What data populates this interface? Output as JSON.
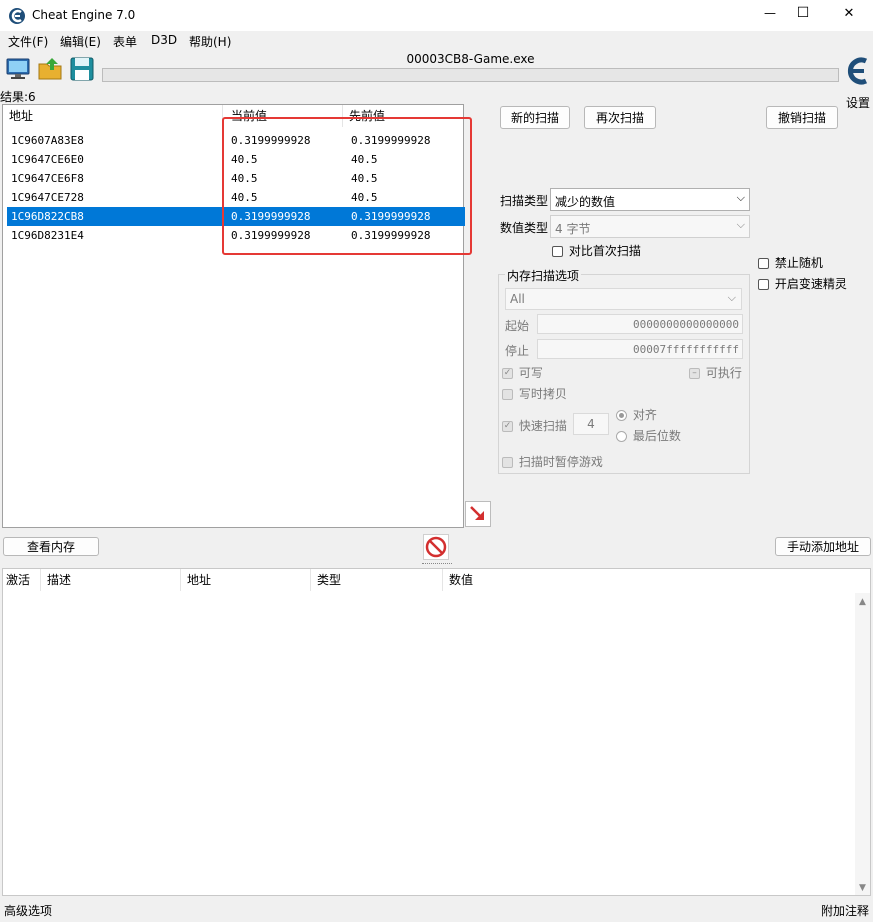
{
  "window": {
    "title": "Cheat Engine 7.0",
    "controls": {
      "minimize": "—",
      "maximize": "☐",
      "close": "✕"
    }
  },
  "menu": [
    "文件(F)",
    "编辑(E)",
    "表单",
    "D3D",
    "帮助(H)"
  ],
  "process_name": "00003CB8-Game.exe",
  "results_label": "结果:6",
  "settings_label": "设置",
  "results_table": {
    "headers": [
      "地址",
      "当前值",
      "先前值"
    ],
    "rows": [
      {
        "address": "1C9607A83E8",
        "current": "0.3199999928",
        "previous": "0.3199999928",
        "selected": false
      },
      {
        "address": "1C9647CE6E0",
        "current": "40.5",
        "previous": "40.5",
        "selected": false
      },
      {
        "address": "1C9647CE6F8",
        "current": "40.5",
        "previous": "40.5",
        "selected": false
      },
      {
        "address": "1C9647CE728",
        "current": "40.5",
        "previous": "40.5",
        "selected": false
      },
      {
        "address": "1C96D822CB8",
        "current": "0.3199999928",
        "previous": "0.3199999928",
        "selected": true
      },
      {
        "address": "1C96D8231E4",
        "current": "0.3199999928",
        "previous": "0.3199999928",
        "selected": false
      }
    ]
  },
  "buttons": {
    "new_scan": "新的扫描",
    "next_scan": "再次扫描",
    "undo_scan": "撤销扫描",
    "view_memory": "查看内存",
    "add_address": "手动添加地址"
  },
  "scan": {
    "scan_type_label": "扫描类型",
    "scan_type_value": "减少的数值",
    "value_type_label": "数值类型",
    "value_type_value": "4 字节",
    "compare_first": "对比首次扫描",
    "disable_random": "禁止随机",
    "speedhack": "开启变速精灵"
  },
  "memory_options": {
    "group_label": "内存扫描选项",
    "region": "All",
    "start_label": "起始",
    "start_value": "0000000000000000",
    "stop_label": "停止",
    "stop_value": "00007fffffffffff",
    "writable": "可写",
    "executable": "可执行",
    "copy_on_write": "写时拷贝",
    "fast_scan": "快速扫描",
    "fast_scan_value": "4",
    "align": "对齐",
    "last_digits": "最后位数",
    "pause_game": "扫描时暂停游戏"
  },
  "address_list": {
    "headers": [
      "激活",
      "描述",
      "地址",
      "类型",
      "数值"
    ]
  },
  "status": {
    "left": "高级选项",
    "right": "附加注释"
  },
  "colors": {
    "selection": "#0078d7",
    "highlight_box": "#e53935"
  }
}
